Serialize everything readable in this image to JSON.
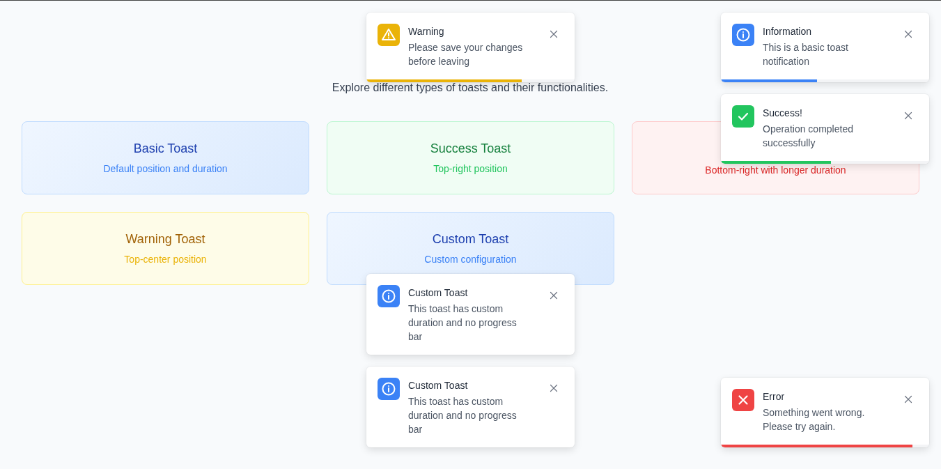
{
  "subtitle": "Explore different types of toasts and their functionalities.",
  "cards": [
    {
      "kind": "info",
      "title": "Basic Toast",
      "description": "Default position and duration"
    },
    {
      "kind": "success",
      "title": "Success Toast",
      "description": "Top-right position"
    },
    {
      "kind": "error",
      "description": "Bottom-right with longer duration"
    },
    {
      "kind": "warning",
      "title": "Warning Toast",
      "description": "Top-center position"
    },
    {
      "kind": "info",
      "title": "Custom Toast",
      "description": "Custom configuration"
    }
  ],
  "toast_stacks": {
    "top_center": [
      {
        "kind": "warning",
        "title": "Warning",
        "message": "Please save your changes before leaving",
        "level": 0.745
      }
    ],
    "top_right": [
      {
        "kind": "info",
        "title": "Information",
        "message": "This is a basic toast notification",
        "level": 0.46
      },
      {
        "kind": "success",
        "title": "Success!",
        "message": "Operation completed successfully",
        "level": 0.53
      }
    ],
    "bottom_center": [
      {
        "kind": "info",
        "title": "Custom Toast",
        "message": "This toast has custom duration and no progress bar"
      },
      {
        "kind": "info",
        "title": "Custom Toast",
        "message": "This toast has custom duration and no progress bar"
      }
    ],
    "bottom_right": [
      {
        "kind": "error",
        "title": "Error",
        "message": "Something went wrong. Please try again.",
        "level": 0.92
      }
    ]
  }
}
